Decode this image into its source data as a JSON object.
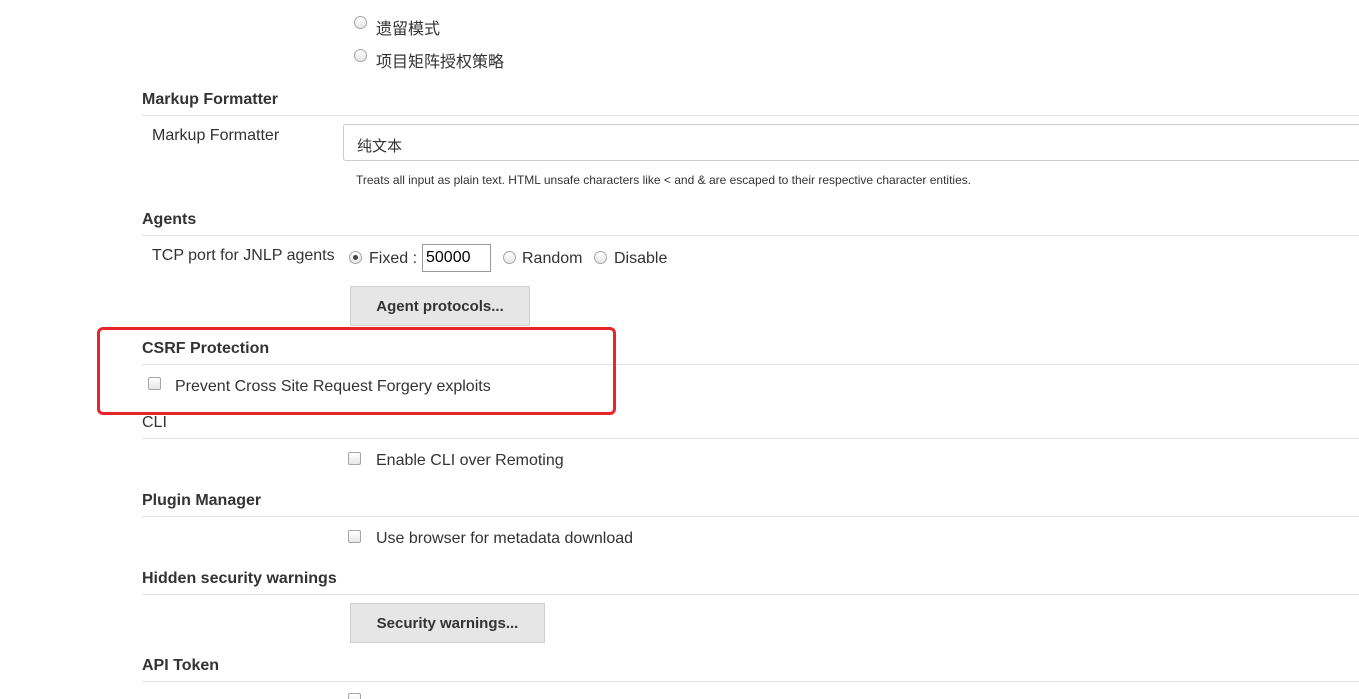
{
  "authorization": {
    "options": [
      {
        "label": "遗留模式",
        "checked": false
      },
      {
        "label": "项目矩阵授权策略",
        "checked": false
      }
    ]
  },
  "markup_formatter": {
    "section_title": "Markup Formatter",
    "field_label": "Markup Formatter",
    "selected_value": "纯文本",
    "help_text": "Treats all input as plain text. HTML unsafe characters like < and & are escaped to their respective character entities."
  },
  "agents": {
    "section_title": "Agents",
    "field_label": "TCP port for JNLP agents",
    "fixed_label": "Fixed :",
    "port_value": "50000",
    "random_label": "Random",
    "disable_label": "Disable",
    "selected": "Fixed",
    "protocols_button": "Agent protocols..."
  },
  "csrf": {
    "section_title": "CSRF Protection",
    "checkbox_label": "Prevent Cross Site Request Forgery exploits",
    "checked": false,
    "highlight_color": "#e8262a"
  },
  "cli": {
    "section_title": "CLI",
    "checkbox_label": "Enable CLI over Remoting",
    "checked": false
  },
  "plugin_manager": {
    "section_title": "Plugin Manager",
    "checkbox_label": "Use browser for metadata download",
    "checked": false
  },
  "hidden_security_warnings": {
    "section_title": "Hidden security warnings",
    "button_label": "Security warnings..."
  },
  "api_token": {
    "section_title": "API Token"
  },
  "colors": {
    "button_bg": "#e6e6e6",
    "rule": "#e2e2e2",
    "text": "#333333"
  }
}
